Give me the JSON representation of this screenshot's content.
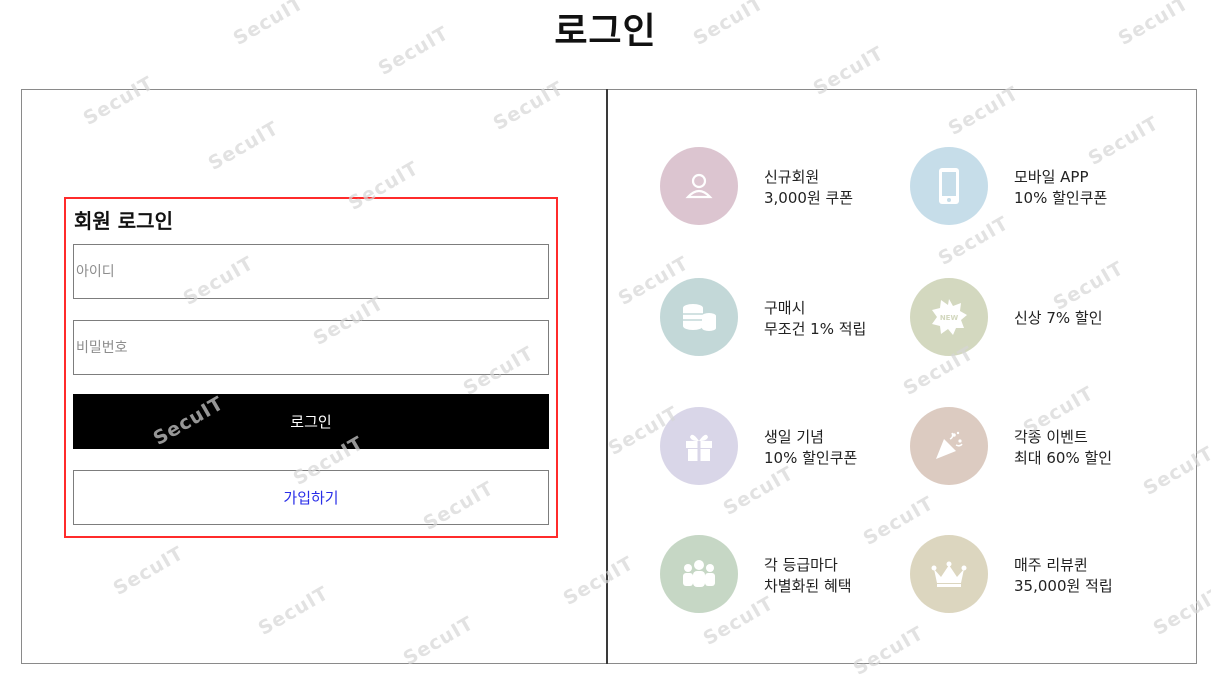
{
  "page": {
    "title": "로그인"
  },
  "login": {
    "heading": "회원 로그인",
    "id_placeholder": "아이디",
    "pw_placeholder": "비밀번호",
    "login_button": "로그인",
    "join_button": "가입하기"
  },
  "benefits": [
    {
      "icon": "user-icon",
      "color": "#dcc5d0",
      "line1": "신규회원",
      "line2": "3,000원 쿠폰"
    },
    {
      "icon": "mobile-icon",
      "color": "#c6dde9",
      "line1": "모바일 APP",
      "line2": "10% 할인쿠폰"
    },
    {
      "icon": "coins-icon",
      "color": "#c3d8d8",
      "line1": "구매시",
      "line2": "무조건 1% 적립"
    },
    {
      "icon": "new-badge-icon",
      "color": "#d3d8bf",
      "line1": "신상 7% 할인",
      "line2": ""
    },
    {
      "icon": "gift-icon",
      "color": "#d9d6e8",
      "line1": "생일 기념",
      "line2": "10% 할인쿠폰"
    },
    {
      "icon": "party-popper-icon",
      "color": "#dccbc1",
      "line1": "각종 이벤트",
      "line2": "최대 60% 할인"
    },
    {
      "icon": "group-icon",
      "color": "#c6d7c5",
      "line1": "각 등급마다",
      "line2": "차별화된 혜택"
    },
    {
      "icon": "crown-icon",
      "color": "#dcd6bf",
      "line1": "매주 리뷰퀸",
      "line2": "35,000원 적립"
    }
  ],
  "watermark": {
    "text": "SecuIT"
  }
}
